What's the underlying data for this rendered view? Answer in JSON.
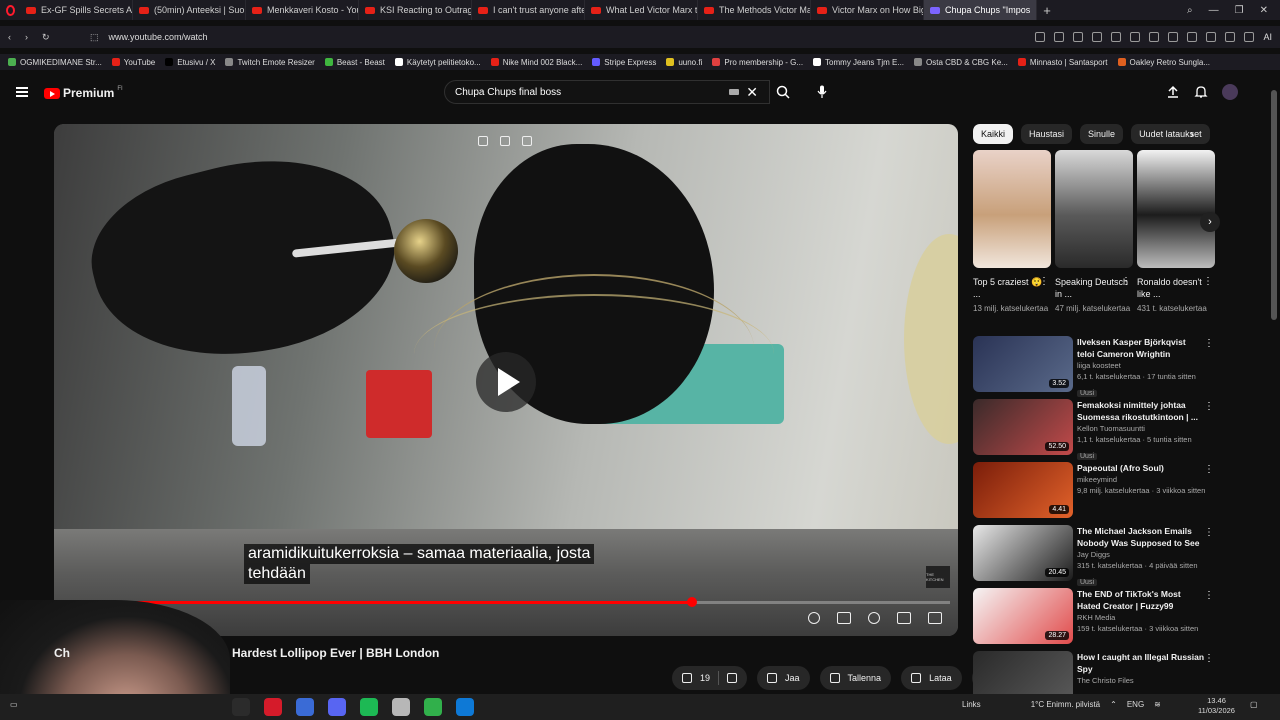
{
  "browser": {
    "tabs": [
      {
        "label": "Ex-GF Spills Secrets About",
        "active": false
      },
      {
        "label": "(50min) Anteeksi | Suome",
        "active": false
      },
      {
        "label": "Menkkaveri Kosto - YouTu",
        "active": false
      },
      {
        "label": "KSI Reacting to Outrageo",
        "active": false
      },
      {
        "label": "I can't trust anyone after t",
        "active": false
      },
      {
        "label": "What Led Victor Marx to E",
        "active": false
      },
      {
        "label": "The Methods Victor Marx",
        "active": false
      },
      {
        "label": "Victor Marx on How Big T",
        "active": false
      },
      {
        "label": "Chupa Chups \"Impos",
        "active": true
      }
    ],
    "url": "www.youtube.com/watch",
    "ai_label": "AI",
    "bookmarks": [
      "OGMIKEDIMANE Str...",
      "YouTube",
      "Etusivu / X",
      "Twitch Emote Resizer",
      "Beast - Beast",
      "Käytetyt pelitietoko...",
      "Nike Mind 002 Black...",
      "Stripe Express",
      "uuno.fi",
      "Pro membership - G...",
      "Tommy Jeans Tjm E...",
      "Osta CBD & CBG Ke...",
      "Minnasto | Santasport",
      "Oakley Retro Sungla..."
    ]
  },
  "youtube": {
    "logo_text": "Premium",
    "logo_sup": "FI",
    "search_value": "Chupa Chups final boss",
    "player": {
      "subtitle_line1": "aramidikuitukerroksia – samaa materiaalia, josta",
      "subtitle_line2": "tehdään",
      "watermark": "THE KITCHEN",
      "progress": 0.71
    },
    "video_title": "Ch... Hardest Lollipop Ever | BBH London",
    "video_title_visible": "Hardest Lollipop Ever | BBH London",
    "video_title_prefix": "Ch",
    "actions": {
      "likes": "19",
      "share": "Jaa",
      "save": "Tallenna",
      "download": "Lataa"
    },
    "chips": [
      "Kaikki",
      "Haustasi",
      "Sinulle",
      "Uudet lataukset"
    ],
    "shorts": [
      {
        "title": "Top 5 craziest 😲 ...",
        "views": "13 milj. katselukertaa",
        "colors": [
          "#e9d2c8",
          "#c8a07a",
          "#f1e6dc"
        ]
      },
      {
        "title": "Speaking Deutsch in ...",
        "views": "47 milj. katselukertaa",
        "colors": [
          "#d9d9d9",
          "#5a5a5a",
          "#2a2a2a"
        ]
      },
      {
        "title": "Ronaldo doesn't like ...",
        "views": "431 t. katselukertaa",
        "colors": [
          "#f2f2f2",
          "#1c1c1c",
          "#bdbdbd"
        ]
      }
    ],
    "related": [
      {
        "title": "Ilveksen Kasper Björkqvist teloi Cameron Wrightin",
        "channel": "liiga koosteet",
        "views": "6,1 t. katselukertaa · 17 tuntia sitten",
        "duration": "3.52",
        "new": "Uusi",
        "colors": [
          "#2a3355",
          "#5a6a8a"
        ]
      },
      {
        "title": "Femakoksi nimittely johtaa Suomessa rikostutkintoon | ...",
        "channel": "Kellon Tuomasuuntti",
        "views": "1,1 t. katselukertaa · 5 tuntia sitten",
        "duration": "52.50",
        "new": "Uusi",
        "colors": [
          "#3a2a2a",
          "#c24a4a"
        ]
      },
      {
        "title": "Papeoutal (Afro Soul)",
        "channel": "mikeeymind",
        "views": "9,8 milj. katselukertaa · 3 viikkoa sitten",
        "duration": "4.41",
        "new": "",
        "colors": [
          "#7a1d0a",
          "#e2622a"
        ]
      },
      {
        "title": "The Michael Jackson Emails Nobody Was Supposed to See",
        "channel": "Jay Diggs",
        "views": "315 t. katselukertaa · 4 päivää sitten",
        "duration": "20.45",
        "new": "Uusi",
        "colors": [
          "#e8e8e8",
          "#1b1b1b"
        ]
      },
      {
        "title": "The END of TikTok's Most Hated Creator | Fuzzy99",
        "channel": "RKH Media",
        "views": "159 t. katselukertaa · 3 viikkoa sitten",
        "duration": "28.27",
        "new": "",
        "colors": [
          "#f5f5f5",
          "#e14b4b"
        ]
      },
      {
        "title": "How I caught an Illegal Russian Spy",
        "channel": "The Christo Files",
        "views": "",
        "duration": "",
        "new": "",
        "colors": [
          "#2a2a2a",
          "#5a5a5a"
        ]
      }
    ]
  },
  "taskbar": {
    "links_label": "Links",
    "weather": "1°C  Enimm. pilvistä",
    "lang": "ENG",
    "time": "13.46",
    "date": "11/03/2026"
  },
  "colors": {
    "accent": "#ff0000",
    "bg": "#0f0f0f",
    "chip": "#272727"
  }
}
